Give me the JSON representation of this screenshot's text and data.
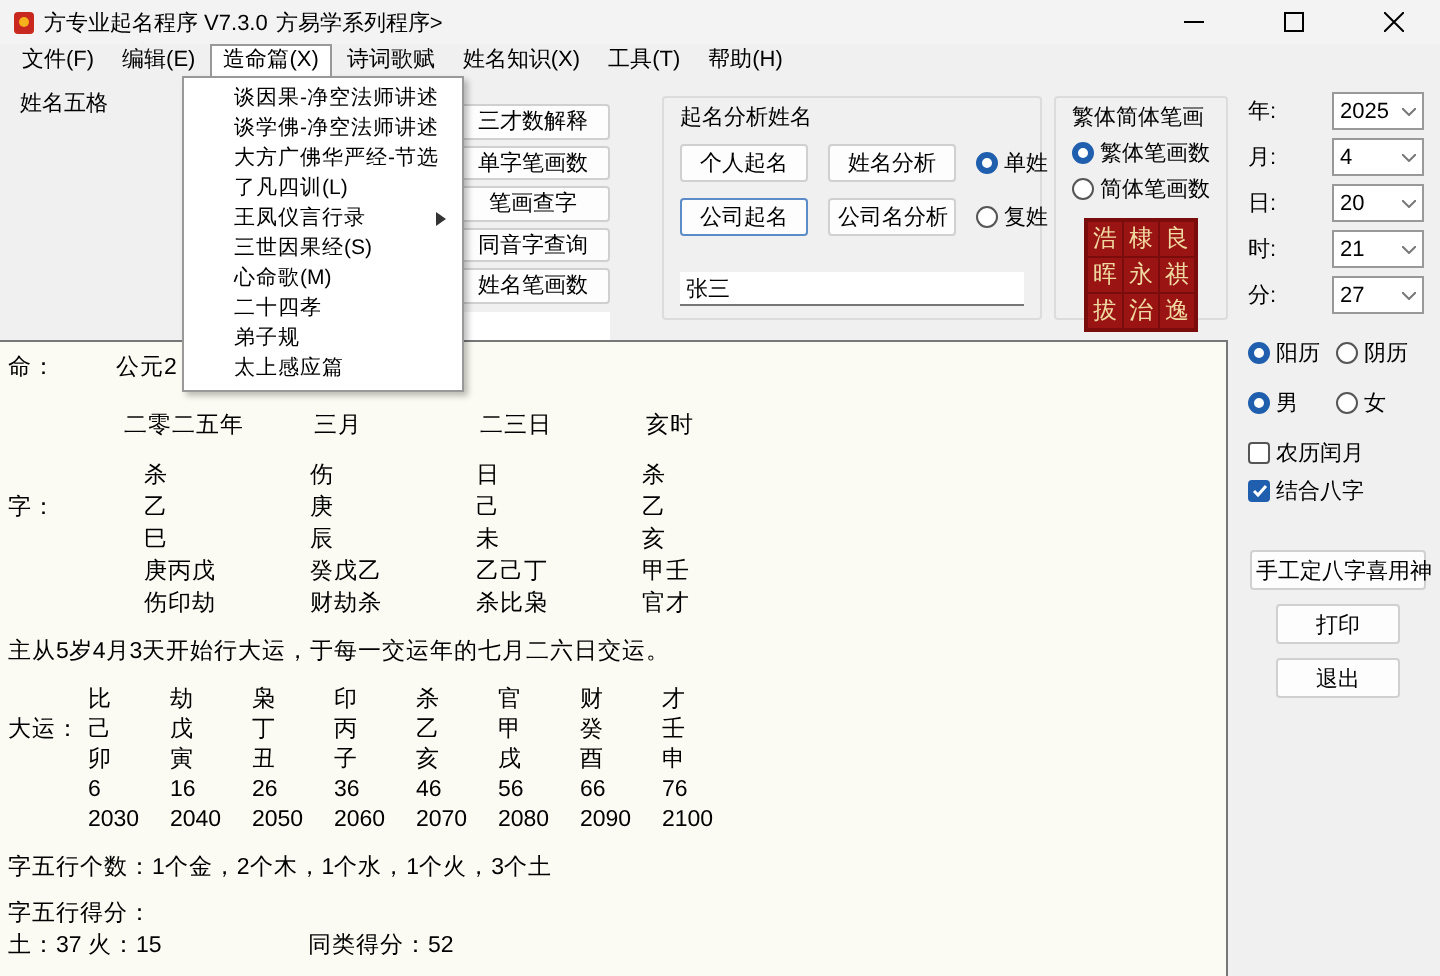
{
  "window": {
    "title_1": "方专业起名程序 V7.3.0",
    "title_2": "方易学系列程序>"
  },
  "menu": [
    {
      "label": "文件(F)",
      "selected": false
    },
    {
      "label": "编辑(E)",
      "selected": false
    },
    {
      "label": "造命篇(X)",
      "selected": true
    },
    {
      "label": "诗词歌赋",
      "selected": false
    },
    {
      "label": "姓名知识(X)",
      "selected": false
    },
    {
      "label": "工具(T)",
      "selected": false
    },
    {
      "label": "帮助(H)",
      "selected": false
    }
  ],
  "dropdown": [
    {
      "label": "谈因果-净空法师讲述",
      "submenu": false
    },
    {
      "label": "谈学佛-净空法师讲述",
      "submenu": false
    },
    {
      "label": "大方广佛华严经-节选",
      "submenu": false
    },
    {
      "label": "了凡四训(L)",
      "submenu": false
    },
    {
      "label": "王凤仪言行录",
      "submenu": true
    },
    {
      "label": "三世因果经(S)",
      "submenu": false
    },
    {
      "label": "心命歌(M)",
      "submenu": false
    },
    {
      "label": "二十四孝",
      "submenu": false
    },
    {
      "label": "弟子规",
      "submenu": false
    },
    {
      "label": "太上感应篇",
      "submenu": false
    }
  ],
  "left_group": {
    "title": "姓名五格"
  },
  "tool_buttons": [
    "三才数解释",
    "单字笔画数",
    "笔画查字",
    "同音字查询",
    "姓名笔画数"
  ],
  "analysis": {
    "title": "起名分析姓名",
    "buttons": [
      {
        "label": "个人起名",
        "focused": false
      },
      {
        "label": "姓名分析",
        "focused": false
      },
      {
        "label": "公司起名",
        "focused": true
      },
      {
        "label": "公司名分析",
        "focused": false
      }
    ],
    "surname": [
      {
        "label": "单姓",
        "selected": true
      },
      {
        "label": "复姓",
        "selected": false
      }
    ],
    "name_value": "张三"
  },
  "strokes": {
    "title": "繁体简体笔画",
    "options": [
      {
        "label": "繁体笔画数",
        "selected": true
      },
      {
        "label": "简体笔画数",
        "selected": false
      }
    ],
    "sample_chars": [
      "浩",
      "棣",
      "良",
      "晖",
      "永",
      "祺",
      "拔",
      "治",
      "逸"
    ]
  },
  "date_fields": [
    {
      "label": "年:",
      "value": "2025"
    },
    {
      "label": "月:",
      "value": "4"
    },
    {
      "label": "日:",
      "value": "20"
    },
    {
      "label": "时:",
      "value": "21"
    },
    {
      "label": "分:",
      "value": "27"
    }
  ],
  "calendar": [
    {
      "label": "阳历",
      "selected": true
    },
    {
      "label": "阴历",
      "selected": false
    }
  ],
  "gender": [
    {
      "label": "男",
      "selected": true
    },
    {
      "label": "女",
      "selected": false
    }
  ],
  "checks": [
    {
      "label": "农历闰月",
      "checked": false
    },
    {
      "label": "结合八字",
      "checked": true
    }
  ],
  "actions": [
    "手工定八字喜用神",
    "打印",
    "退出"
  ],
  "report": {
    "birth_label": "命：",
    "birth_value": "公元2",
    "date_row": [
      "二零二五年",
      "三月",
      "二三日",
      "亥时"
    ],
    "bazi_label": "字：",
    "bazi_rows": [
      [
        "杀",
        "伤",
        "日",
        "杀"
      ],
      [
        "乙",
        "庚",
        "己",
        "乙"
      ],
      [
        "巳",
        "辰",
        "未",
        "亥"
      ],
      [
        "庚丙戊",
        "癸戊乙",
        "乙己丁",
        "甲壬"
      ],
      [
        "伤印劫",
        "财劫杀",
        "杀比枭",
        "官才"
      ]
    ],
    "luck_start": "主从5岁4月3天开始行大运，于每一交运年的七月二六日交运。",
    "dayun_label": "大运：",
    "dayun_rows": [
      [
        "比",
        "劫",
        "枭",
        "印",
        "杀",
        "官",
        "财",
        "才"
      ],
      [
        "己",
        "戊",
        "丁",
        "丙",
        "乙",
        "甲",
        "癸",
        "壬"
      ],
      [
        "卯",
        "寅",
        "丑",
        "子",
        "亥",
        "戌",
        "酉",
        "申"
      ],
      [
        "6",
        "16",
        "26",
        "36",
        "46",
        "56",
        "66",
        "76"
      ],
      [
        "2030",
        "2040",
        "2050",
        "2060",
        "2070",
        "2080",
        "2090",
        "2100"
      ]
    ],
    "wuxing_count": "字五行个数：1个金，2个木，1个水，1个火，3个土",
    "wuxing_score_title": "字五行得分：",
    "score_left": "土：37  火：15",
    "score_right": "同类得分：52"
  }
}
